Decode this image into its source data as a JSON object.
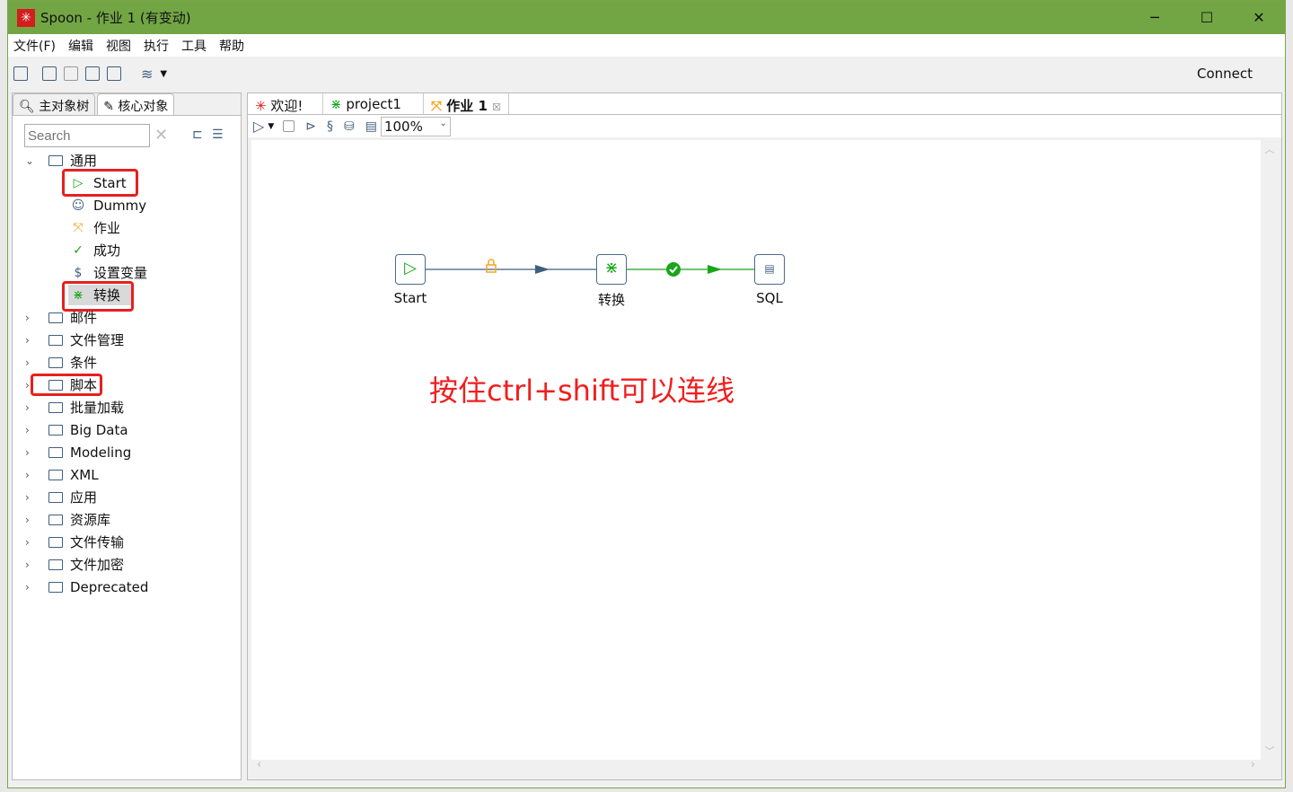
{
  "window": {
    "title": "Spoon - 作业 1 (有变动)",
    "minimize": "─",
    "maximize": "☐",
    "close": "✕"
  },
  "menu": [
    "文件(F)",
    "编辑",
    "视图",
    "执行",
    "工具",
    "帮助"
  ],
  "toolbar": {
    "connect": "Connect"
  },
  "left_panel": {
    "tabs": [
      "主对象树",
      "核心对象"
    ],
    "search_placeholder": "Search",
    "tree": [
      {
        "label": "通用",
        "expanded": true,
        "children": [
          {
            "label": "Start",
            "icon": "play-icon",
            "highlighted": true
          },
          {
            "label": "Dummy",
            "icon": "dummy-icon"
          },
          {
            "label": "作业",
            "icon": "job-icon"
          },
          {
            "label": "成功",
            "icon": "check-icon"
          },
          {
            "label": "设置变量",
            "icon": "variable-icon"
          },
          {
            "label": "转换",
            "icon": "transform-icon",
            "highlighted": true,
            "selected": true
          }
        ]
      },
      {
        "label": "邮件"
      },
      {
        "label": "文件管理"
      },
      {
        "label": "条件"
      },
      {
        "label": "脚本",
        "highlighted": true
      },
      {
        "label": "批量加载"
      },
      {
        "label": "Big Data"
      },
      {
        "label": "Modeling"
      },
      {
        "label": "XML"
      },
      {
        "label": "应用"
      },
      {
        "label": "资源库"
      },
      {
        "label": "文件传输"
      },
      {
        "label": "文件加密"
      },
      {
        "label": "Deprecated"
      }
    ]
  },
  "editor": {
    "tabs": [
      "欢迎!",
      "project1",
      "作业 1"
    ],
    "active_tab": "作业 1",
    "zoom": "100%",
    "nodes": [
      {
        "label": "Start"
      },
      {
        "label": "转换"
      },
      {
        "label": "SQL"
      }
    ],
    "hops": [
      {
        "from": "Start",
        "to": "转换",
        "type": "unconditional",
        "color": "#3f5f7f"
      },
      {
        "from": "转换",
        "to": "SQL",
        "type": "success",
        "color": "#1aa51a"
      }
    ],
    "annotation": "按住ctrl+shift可以连线"
  },
  "colors": {
    "titlebar": "#72a644",
    "highlight": "#e62020",
    "annotation": "#f01e1e"
  }
}
